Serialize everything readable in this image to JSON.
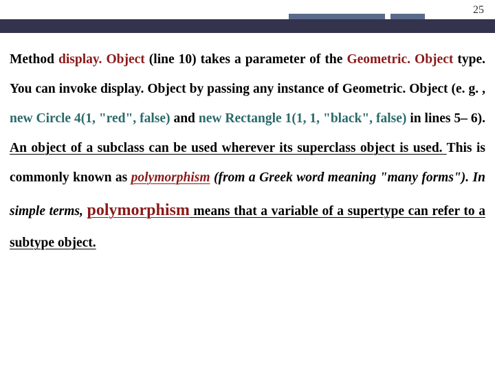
{
  "page_number": "25",
  "t": {
    "a1": "Method ",
    "a2": "display. Object",
    "a3": " (line 10) takes a parameter of the ",
    "a4": "Geometric. Object",
    "a5": " type. You can invoke display. Object by passing any instance of Geometric. Object (e. g. , ",
    "a6": "new Circle 4(1, \"red\", false)",
    "a7": " and ",
    "a8": "new Rectangle 1(1, 1, \"black\", false)",
    "a9": " in lines 5– 6). ",
    "b1": "An object of a subclass can be used wherever its superclass object is used. ",
    "b2": "This is commonly known as ",
    "c1": "polymorphism",
    "c2": " (from a Greek word meaning \"many forms\"). In simple terms, ",
    "d1": "polymorphism",
    "d2": " means that a variable of a supertype can refer to a subtype object.",
    "colors": {
      "red": "#8a1a1a",
      "teal": "#2a6a6a",
      "band": "#33334d",
      "accent": "#5a6a8a"
    }
  }
}
